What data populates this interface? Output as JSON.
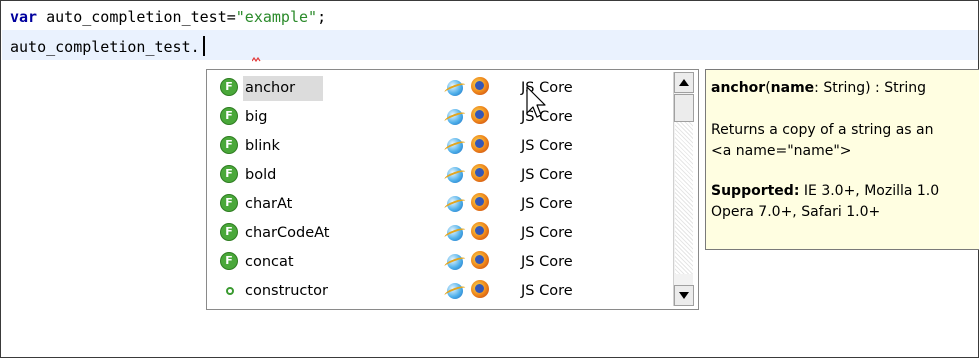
{
  "editor": {
    "line1": {
      "keyword": "var",
      "identifier": " auto_completion_test=",
      "string": "\"example\"",
      "terminator": ";"
    },
    "line2": {
      "text": "auto_completion_test."
    }
  },
  "completion": {
    "items": [
      {
        "name": "anchor",
        "kind": "function",
        "icon_label": "F",
        "library": "JS Core",
        "selected": true
      },
      {
        "name": "big",
        "kind": "function",
        "icon_label": "F",
        "library": "JS Core",
        "selected": false
      },
      {
        "name": "blink",
        "kind": "function",
        "icon_label": "F",
        "library": "JS Core",
        "selected": false
      },
      {
        "name": "bold",
        "kind": "function",
        "icon_label": "F",
        "library": "JS Core",
        "selected": false
      },
      {
        "name": "charAt",
        "kind": "function",
        "icon_label": "F",
        "library": "JS Core",
        "selected": false
      },
      {
        "name": "charCodeAt",
        "kind": "function",
        "icon_label": "F",
        "library": "JS Core",
        "selected": false
      },
      {
        "name": "concat",
        "kind": "function",
        "icon_label": "F",
        "library": "JS Core",
        "selected": false
      },
      {
        "name": "constructor",
        "kind": "property",
        "icon_label": "",
        "library": "JS Core",
        "selected": false
      }
    ],
    "browser_icons": [
      "internet-explorer-icon",
      "firefox-icon"
    ]
  },
  "doc": {
    "sig_name": "anchor",
    "sig_open": "(",
    "param_name": "name",
    "param_type": ": String) : String",
    "desc_line1": "Returns a copy of a string as an",
    "desc_line2": "<a name=\"name\">",
    "supported_label": "Supported:",
    "supported_line1": " IE 3.0+, Mozilla 1.0",
    "supported_line2": "Opera 7.0+, Safari 1.0+"
  },
  "colors": {
    "keyword": "#00009e",
    "string": "#2a8a2a",
    "current_line": "#eaf2fe",
    "tooltip_bg": "#fffee1",
    "function_icon": "#4aa83a"
  }
}
